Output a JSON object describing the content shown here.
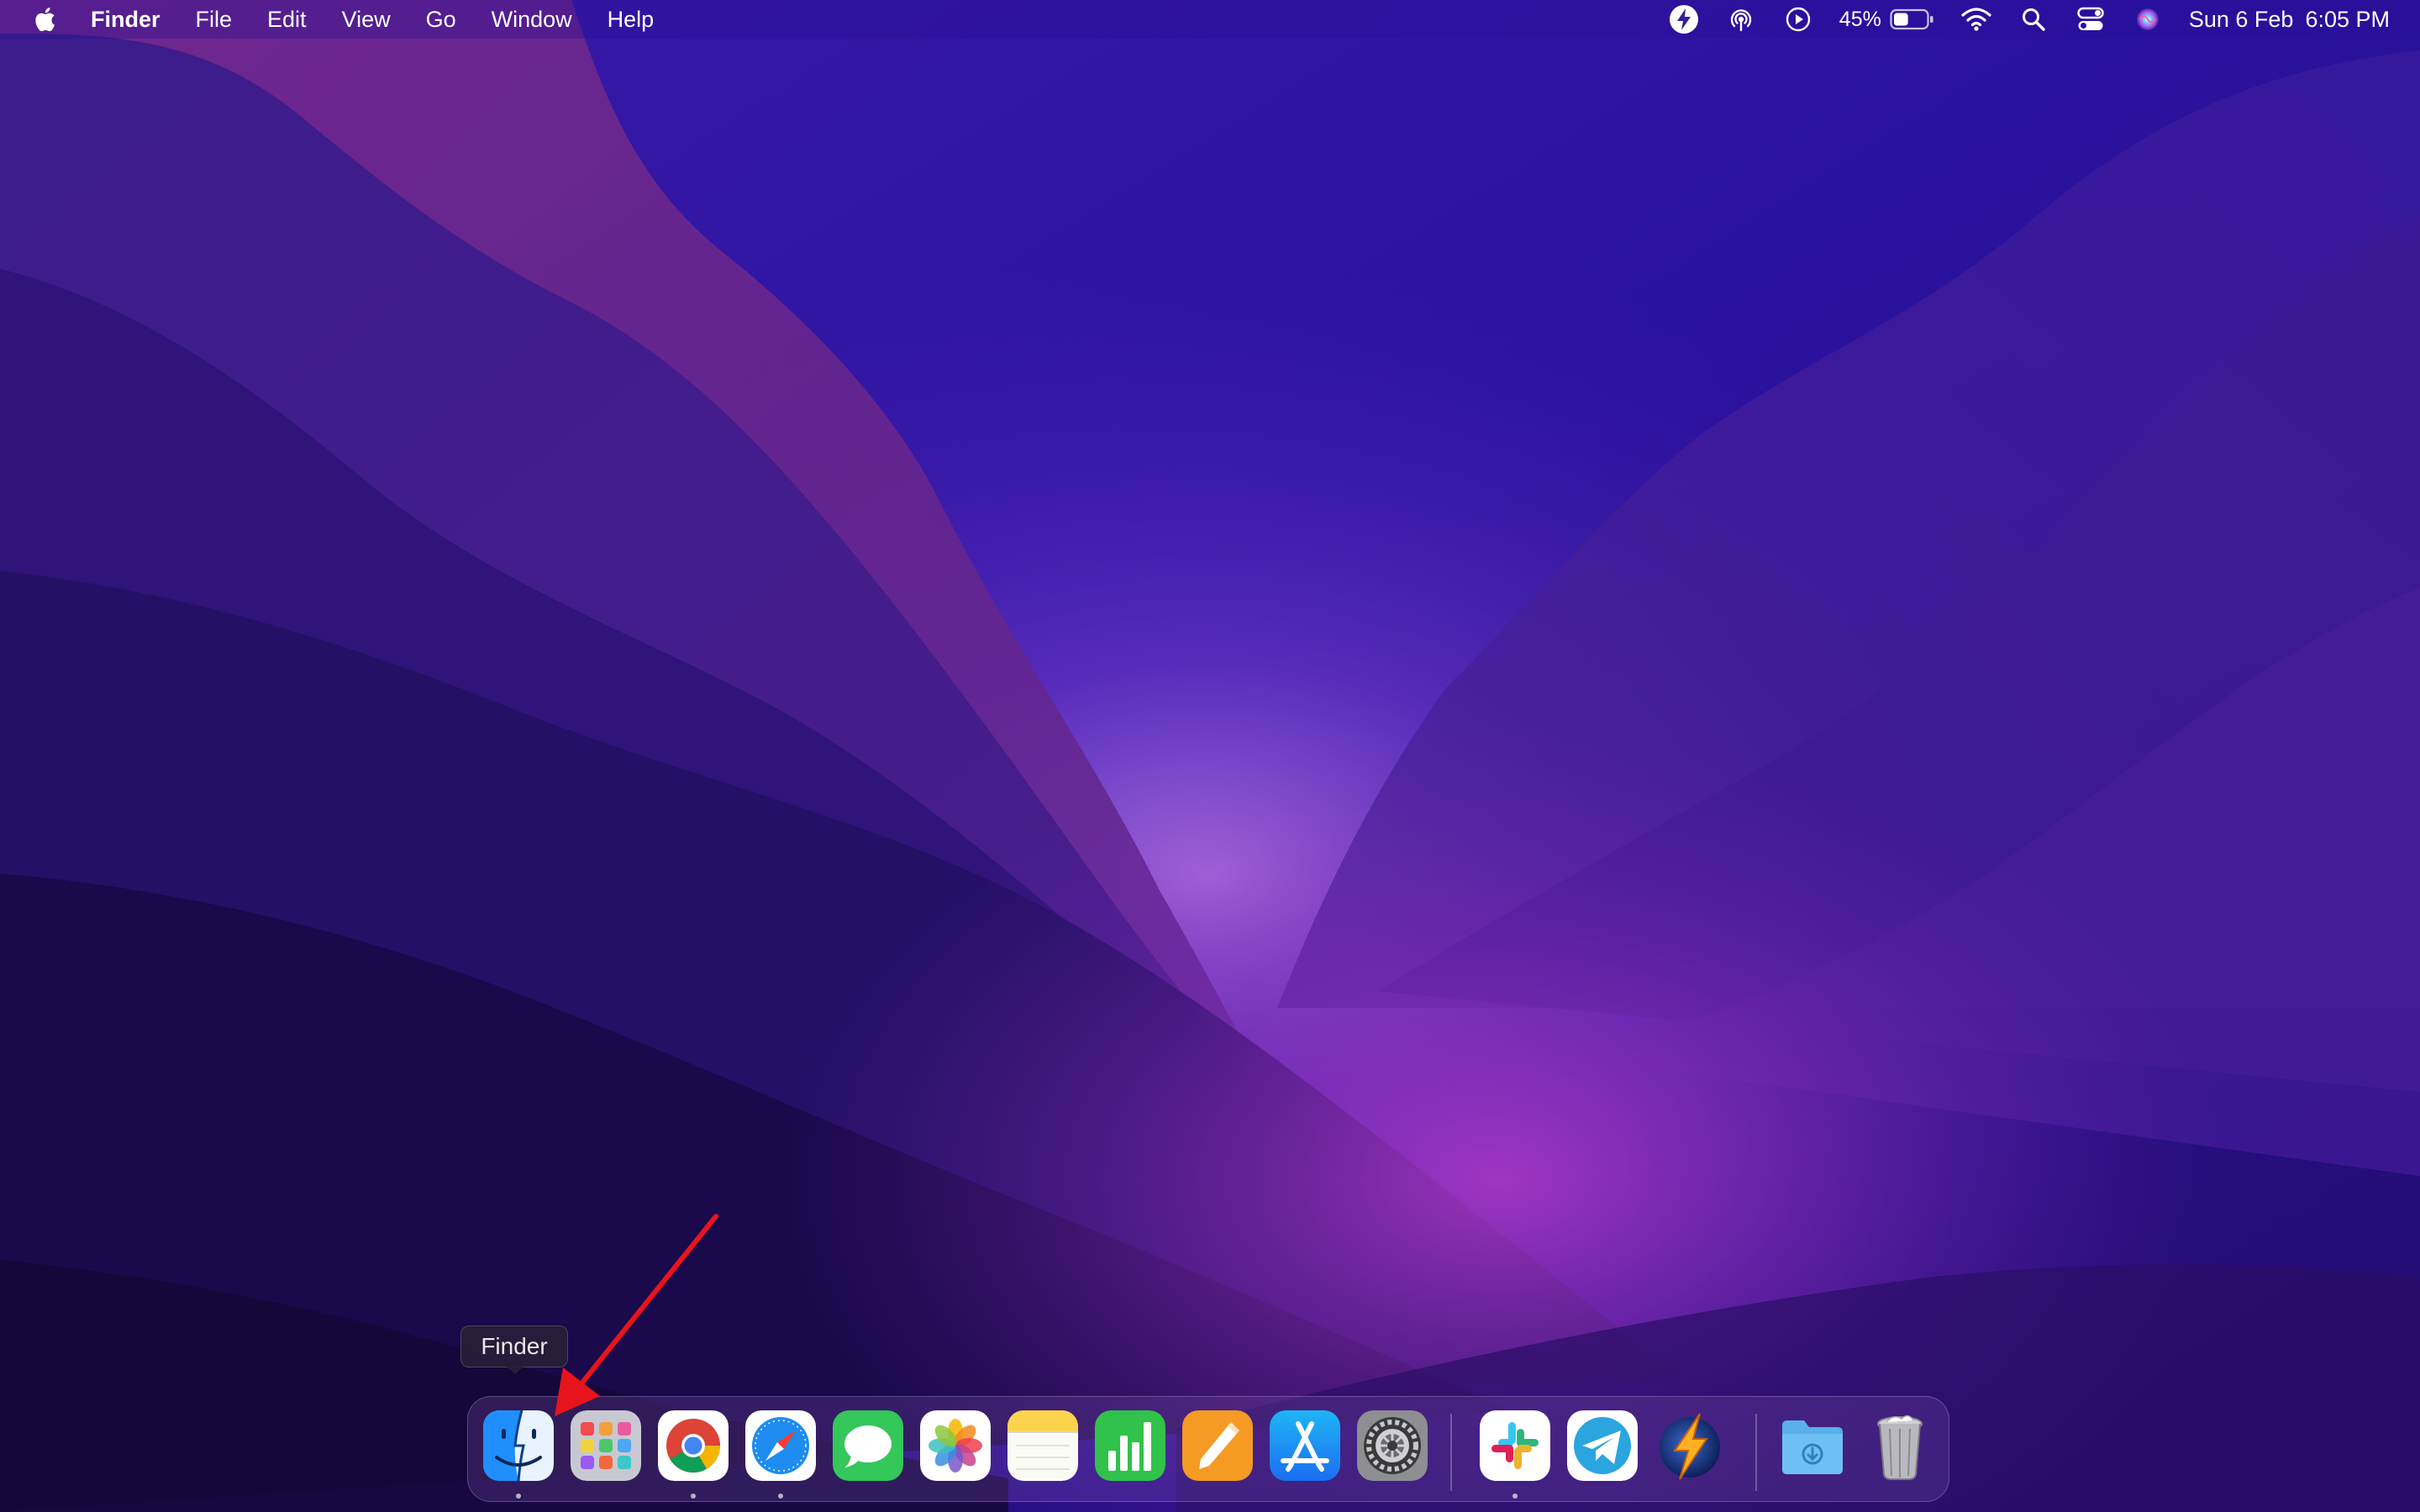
{
  "menubar": {
    "apple_icon": "apple-logo-icon",
    "app_name": "Finder",
    "menus": [
      "File",
      "Edit",
      "View",
      "Go",
      "Window",
      "Help"
    ],
    "status": {
      "icons": [
        "bolt-icon",
        "airdrop-icon",
        "play-icon"
      ],
      "battery_percent": "45%",
      "battery_level": 0.45,
      "right_icons": [
        "wifi-icon",
        "search-icon",
        "control-center-icon",
        "siri-icon"
      ],
      "date": "Sun 6 Feb",
      "time": "6:05 PM"
    }
  },
  "dock": {
    "apps": [
      {
        "name": "Finder",
        "icon": "finder-icon",
        "running": true
      },
      {
        "name": "Launchpad",
        "icon": "launchpad-icon",
        "running": false
      },
      {
        "name": "Google Chrome",
        "icon": "chrome-icon",
        "running": true
      },
      {
        "name": "Safari",
        "icon": "safari-icon",
        "running": true
      },
      {
        "name": "Messages",
        "icon": "messages-icon",
        "running": false
      },
      {
        "name": "Photos",
        "icon": "photos-icon",
        "running": false
      },
      {
        "name": "Notes",
        "icon": "notes-icon",
        "running": false
      },
      {
        "name": "Numbers",
        "icon": "numbers-icon",
        "running": false
      },
      {
        "name": "Pages",
        "icon": "pages-icon",
        "running": false
      },
      {
        "name": "App Store",
        "icon": "app-store-icon",
        "running": false
      },
      {
        "name": "System Preferences",
        "icon": "system-preferences-icon",
        "running": false
      },
      {
        "name": "Slack",
        "icon": "slack-icon",
        "running": true
      },
      {
        "name": "Telegram",
        "icon": "telegram-icon",
        "running": false
      },
      {
        "name": "Reeder",
        "icon": "lightning-app-icon",
        "running": false
      },
      {
        "name": "Downloads",
        "icon": "downloads-folder-icon",
        "running": false
      },
      {
        "name": "Trash",
        "icon": "trash-icon",
        "running": false
      }
    ]
  },
  "tooltip": {
    "label": "Finder"
  },
  "colors": {
    "annotation_arrow": "#e8141c",
    "wallpaper_base": "#1c0a4a",
    "wallpaper_glow": "#9b3fd8"
  }
}
